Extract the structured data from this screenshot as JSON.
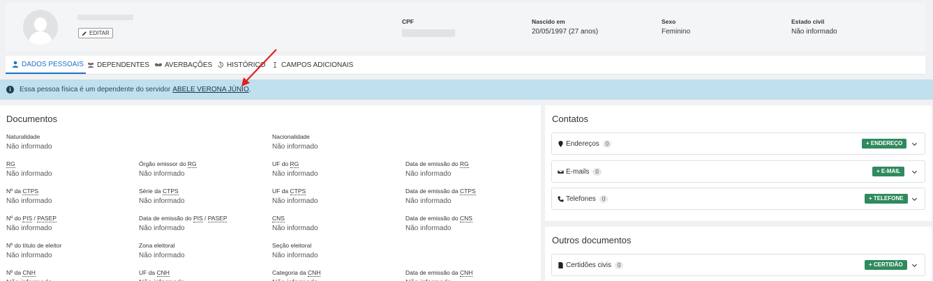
{
  "profile": {
    "edit_label": "EDITAR",
    "cpf_label": "CPF",
    "birth_label": "Nascido em",
    "birth_value": "20/05/1997 (27 anos)",
    "sex_label": "Sexo",
    "sex_value": "Feminino",
    "civil_label": "Estado civil",
    "civil_value": "Não informado"
  },
  "tabs": [
    {
      "label": "DADOS PESSOAIS",
      "icon": "user-icon",
      "active": true
    },
    {
      "label": "DEPENDENTES",
      "icon": "users-icon",
      "active": false
    },
    {
      "label": "AVERBAÇÕES",
      "icon": "handshake-icon",
      "active": false
    },
    {
      "label": "HISTÓRICO",
      "icon": "history-icon",
      "active": false
    },
    {
      "label": "CAMPOS ADICIONAIS",
      "icon": "cursor-icon",
      "active": false
    }
  ],
  "alert": {
    "text": "Essa pessoa física é um dependente do servidor",
    "link": "ABELE VERONA JÚNIO",
    "end": "."
  },
  "documents": {
    "title": "Documentos",
    "empty": "Não informado",
    "fields": {
      "naturalidade": "Naturalidade",
      "nacionalidade": "Nacionalidade",
      "rg": "RG",
      "orgao_pre": "Órgão emissor do ",
      "uf_do": "UF do ",
      "data_emissao_do": "Data de emissão do ",
      "no_da": "Nº da ",
      "ctps": "CTPS",
      "serie_da": "Série da ",
      "uf_da": "UF da ",
      "data_emissao_da": "Data de emissão da ",
      "no_do": "Nº do ",
      "pis": "PIS",
      "slash": " / ",
      "pasep": "PASEP",
      "cns": "CNS",
      "titulo": "Nº do título de eleitor",
      "zona": "Zona eleitoral",
      "secao": "Seção eleitoral",
      "cnh": "CNH",
      "categoria_da": "Categoria da "
    }
  },
  "contacts": {
    "title": "Contatos",
    "rows": [
      {
        "label": "Endereços",
        "count": "0",
        "button": "+ ENDEREÇO",
        "icon": "map-pin-icon"
      },
      {
        "label": "E-mails",
        "count": "0",
        "button": "+ E-MAIL",
        "icon": "envelope-icon"
      },
      {
        "label": "Telefones",
        "count": "0",
        "button": "+ TELEFONE",
        "icon": "phone-icon"
      }
    ]
  },
  "others": {
    "title": "Outros documentos",
    "rows": [
      {
        "label": "Certidões civis",
        "count": "0",
        "button": "+ CERTIDÃO",
        "icon": "file-icon"
      }
    ]
  },
  "colors": {
    "accent": "#1a73c8",
    "alert_bg": "#bfe0ec",
    "button_green": "#2f8a5e",
    "annotation_arrow": "#e02020"
  }
}
